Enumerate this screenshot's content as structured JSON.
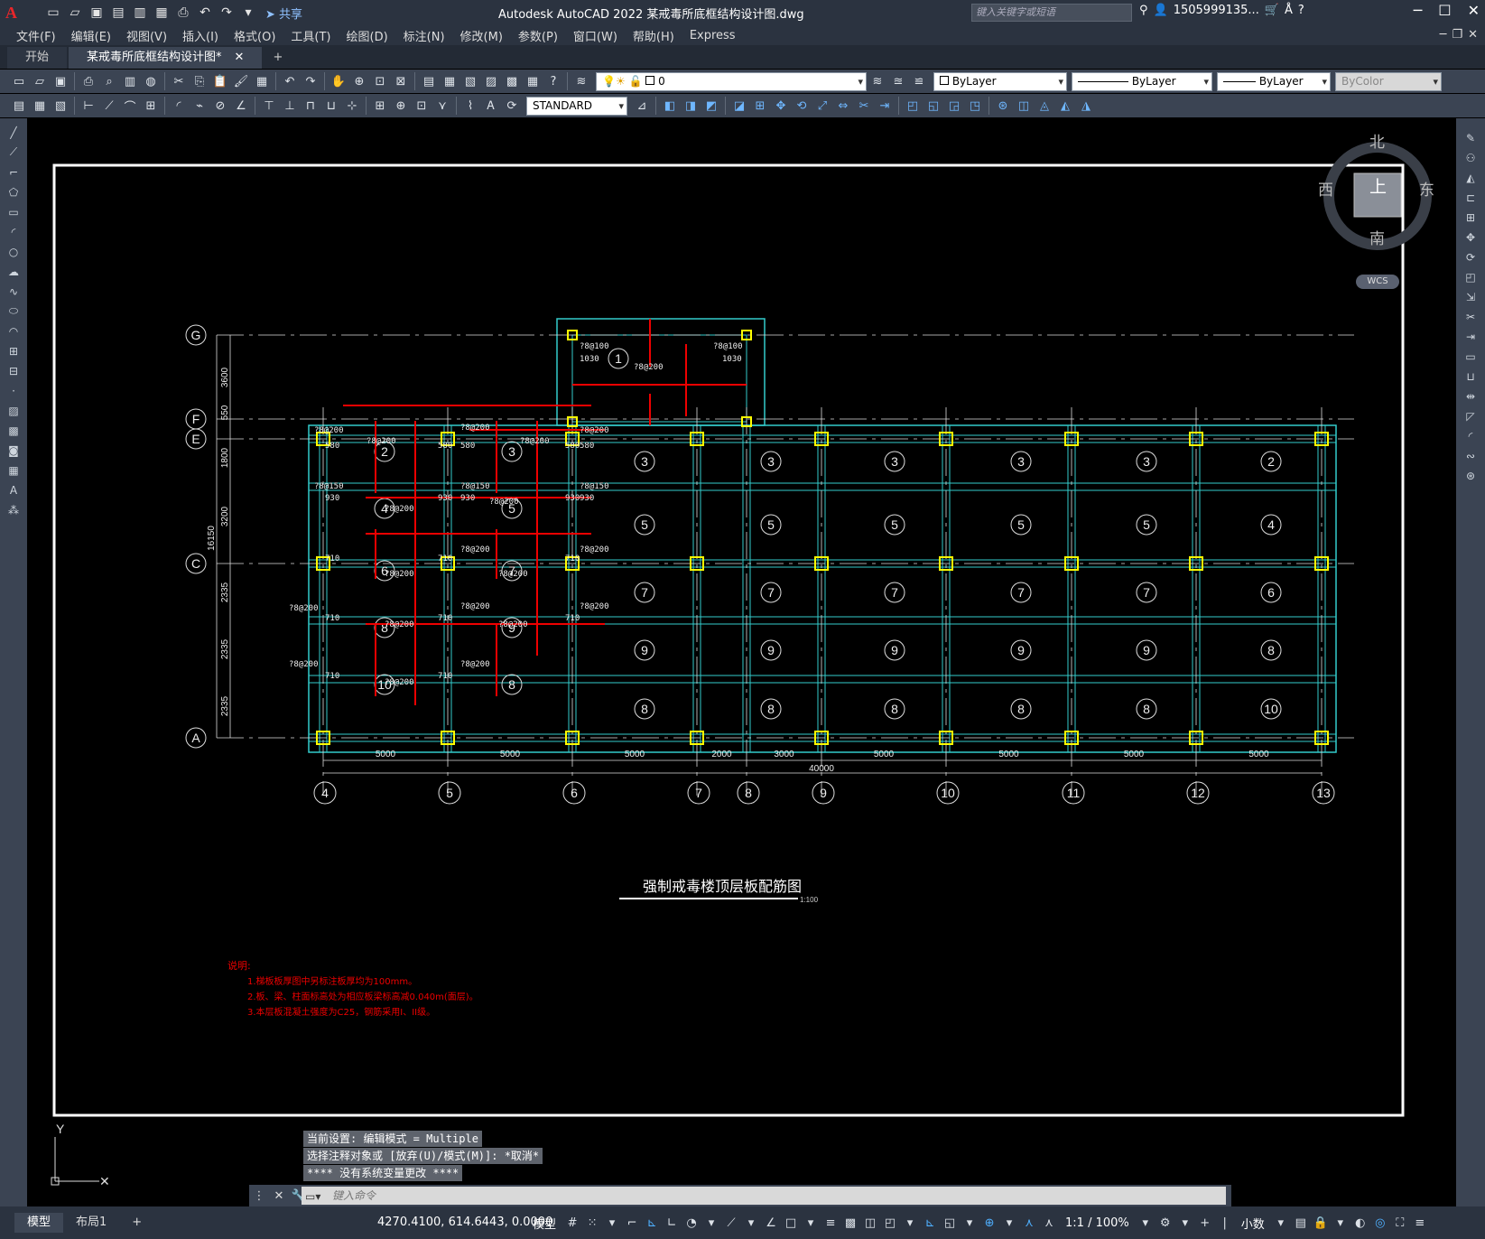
{
  "app": {
    "logo": "A",
    "title": "Autodesk AutoCAD 2022    某戒毒所底框结构设计图.dwg",
    "share_label": "共享",
    "search_placeholder": "键入关键字或短语",
    "user": "1505999135...",
    "qat_icons": [
      "new-icon",
      "open-icon",
      "save-icon",
      "save-as-icon",
      "plot-icon",
      "undo-icon",
      "redo-icon"
    ]
  },
  "menu": [
    "文件(F)",
    "编辑(E)",
    "视图(V)",
    "插入(I)",
    "格式(O)",
    "工具(T)",
    "绘图(D)",
    "标注(N)",
    "修改(M)",
    "参数(P)",
    "窗口(W)",
    "帮助(H)",
    "Express"
  ],
  "tabs": {
    "start": "开始",
    "doc": "某戒毒所底框结构设计图*"
  },
  "toolbar": {
    "layer": "0",
    "text_style": "STANDARD",
    "color": "ByLayer",
    "linetype": "ByLayer",
    "lineweight": "ByLayer",
    "plot_style": "ByColor"
  },
  "viewcube": {
    "north": "北",
    "south": "南",
    "east": "东",
    "west": "西",
    "top": "上",
    "wcs": "WCS"
  },
  "drawing": {
    "title": "强制戒毒楼顶层板配筋图",
    "scale": "1:100",
    "notes_title": "说明:",
    "notes": [
      "1.梯板板厚图中另标注板厚均为100mm。",
      "2.板、梁、柱面标高处为相应板梁标高减0.040m(面层)。",
      "3.本层板混凝土强度为C25，钢筋采用I、II级。"
    ],
    "axes_bottom": [
      "4",
      "5",
      "6",
      "7",
      "8",
      "9",
      "10",
      "11",
      "12",
      "13"
    ],
    "axes_left": [
      "G",
      "F",
      "E",
      "C",
      "A"
    ],
    "dims_bottom": [
      "5000",
      "5000",
      "5000",
      "2000",
      "3000",
      "5000",
      "5000",
      "5000",
      "5000"
    ],
    "dim_total": "40000",
    "dims_left": [
      "3600",
      "550",
      "1800",
      "3200",
      "2335",
      "2335",
      "2335"
    ],
    "dim_left_total": "16150",
    "slab_rows": [
      [
        "3",
        "3",
        "3",
        "3",
        "3",
        "2"
      ],
      [
        "5",
        "5",
        "5",
        "5",
        "5",
        "4"
      ],
      [
        "7",
        "7",
        "7",
        "7",
        "7",
        "6"
      ],
      [
        "9",
        "9",
        "9",
        "9",
        "9",
        "8"
      ],
      [
        "8",
        "8",
        "8",
        "8",
        "8",
        "10"
      ]
    ],
    "slab_left": [
      [
        "2",
        "3"
      ],
      [
        "4",
        "5"
      ],
      [
        "6",
        "7"
      ],
      [
        "8",
        "9"
      ],
      [
        "10",
        "8"
      ]
    ],
    "slab_top": "1",
    "rebar_labels": [
      "?8@200",
      "?8@100",
      "?8@150",
      "580",
      "930",
      "710",
      "1030",
      "1140",
      "?10@130"
    ]
  },
  "ucs": {
    "y": "Y"
  },
  "command": {
    "history": [
      "当前设置: 编辑模式 = Multiple",
      "选择注释对象或 [放弃(U)/模式(M)]: *取消*",
      "**** 没有系统变量更改 ****"
    ],
    "placeholder": "键入命令"
  },
  "status": {
    "layout_tabs": [
      "模型",
      "布局1"
    ],
    "coords": "4270.4100, 614.6443, 0.0000",
    "space": "模型",
    "scale": "1:1 / 100%",
    "units": "小数"
  }
}
